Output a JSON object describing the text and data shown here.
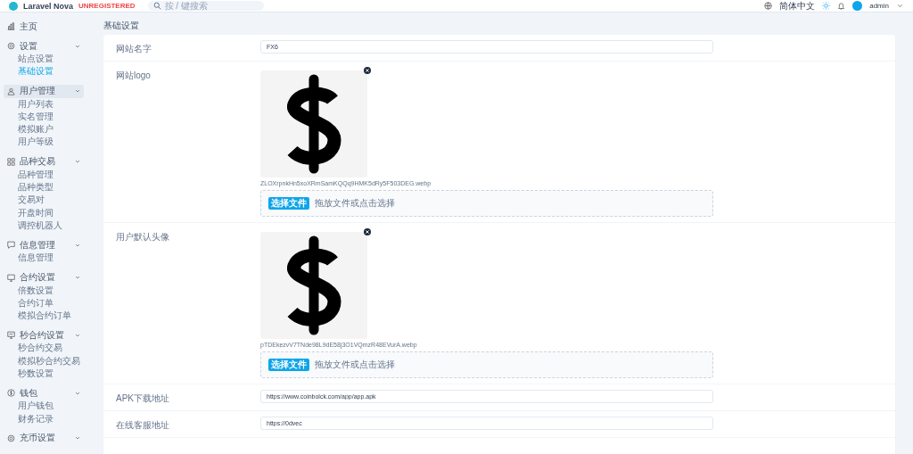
{
  "header": {
    "brand": "Laravel Nova",
    "badge": "UNREGISTERED",
    "search_placeholder": "按 / 键搜索",
    "language": "简体中文",
    "user": "admin"
  },
  "sidebar": [
    {
      "label": "主页",
      "selected": false
    },
    {
      "label": "设置",
      "selected": false,
      "expanded": true,
      "children": [
        {
          "label": "站点设置",
          "selected": false
        },
        {
          "label": "基础设置",
          "selected": true
        }
      ]
    },
    {
      "label": "用户管理",
      "selected": true,
      "expanded": true,
      "children": [
        {
          "label": "用户列表",
          "selected": false
        },
        {
          "label": "实名管理",
          "selected": false
        },
        {
          "label": "模拟账户",
          "selected": false
        },
        {
          "label": "用户等级",
          "selected": false
        }
      ]
    },
    {
      "label": "品种交易",
      "selected": false,
      "expanded": true,
      "children": [
        {
          "label": "品种管理",
          "selected": false
        },
        {
          "label": "品种类型",
          "selected": false
        },
        {
          "label": "交易对",
          "selected": false
        },
        {
          "label": "开盘时间",
          "selected": false
        },
        {
          "label": "调控机器人",
          "selected": false
        }
      ]
    },
    {
      "label": "信息管理",
      "selected": false,
      "expanded": true,
      "children": [
        {
          "label": "信息管理",
          "selected": false
        }
      ]
    },
    {
      "label": "合约设置",
      "selected": false,
      "expanded": true,
      "children": [
        {
          "label": "倍数设置",
          "selected": false
        },
        {
          "label": "合约订单",
          "selected": false
        },
        {
          "label": "模拟合约订单",
          "selected": false
        }
      ]
    },
    {
      "label": "秒合约设置",
      "selected": false,
      "expanded": true,
      "children": [
        {
          "label": "秒合约交易",
          "selected": false
        },
        {
          "label": "模拟秒合约交易",
          "selected": false
        },
        {
          "label": "秒数设置",
          "selected": false
        }
      ]
    },
    {
      "label": "钱包",
      "selected": false,
      "expanded": true,
      "children": [
        {
          "label": "用户钱包",
          "selected": false
        },
        {
          "label": "财务记录",
          "selected": false
        }
      ]
    },
    {
      "label": "充币设置",
      "selected": false,
      "expanded": true
    }
  ],
  "page": {
    "title": "基础设置",
    "fields": [
      {
        "kind": "text",
        "label": "网站名字",
        "value": "FX6"
      },
      {
        "label": "网站logo",
        "filename": "ZLOXrpnkHn5xoXRmSamKQQq9HMK5dRy5F503DEG.webp",
        "button": "选择文件",
        "hint": "拖放文件或点击选择"
      },
      {
        "label": "用户默认头像",
        "filename": "pTDEkezvV7TNde98L9dE58j3O1VQmzR48EVurA.webp",
        "button": "选择文件",
        "hint": "拖放文件或点击选择"
      },
      {
        "kind": "text",
        "label": "APK下载地址",
        "value": "https://www.coinbolck.com/app/app.apk"
      },
      {
        "kind": "text",
        "label": "在线客服地址",
        "value": "https://0dvec"
      }
    ]
  }
}
